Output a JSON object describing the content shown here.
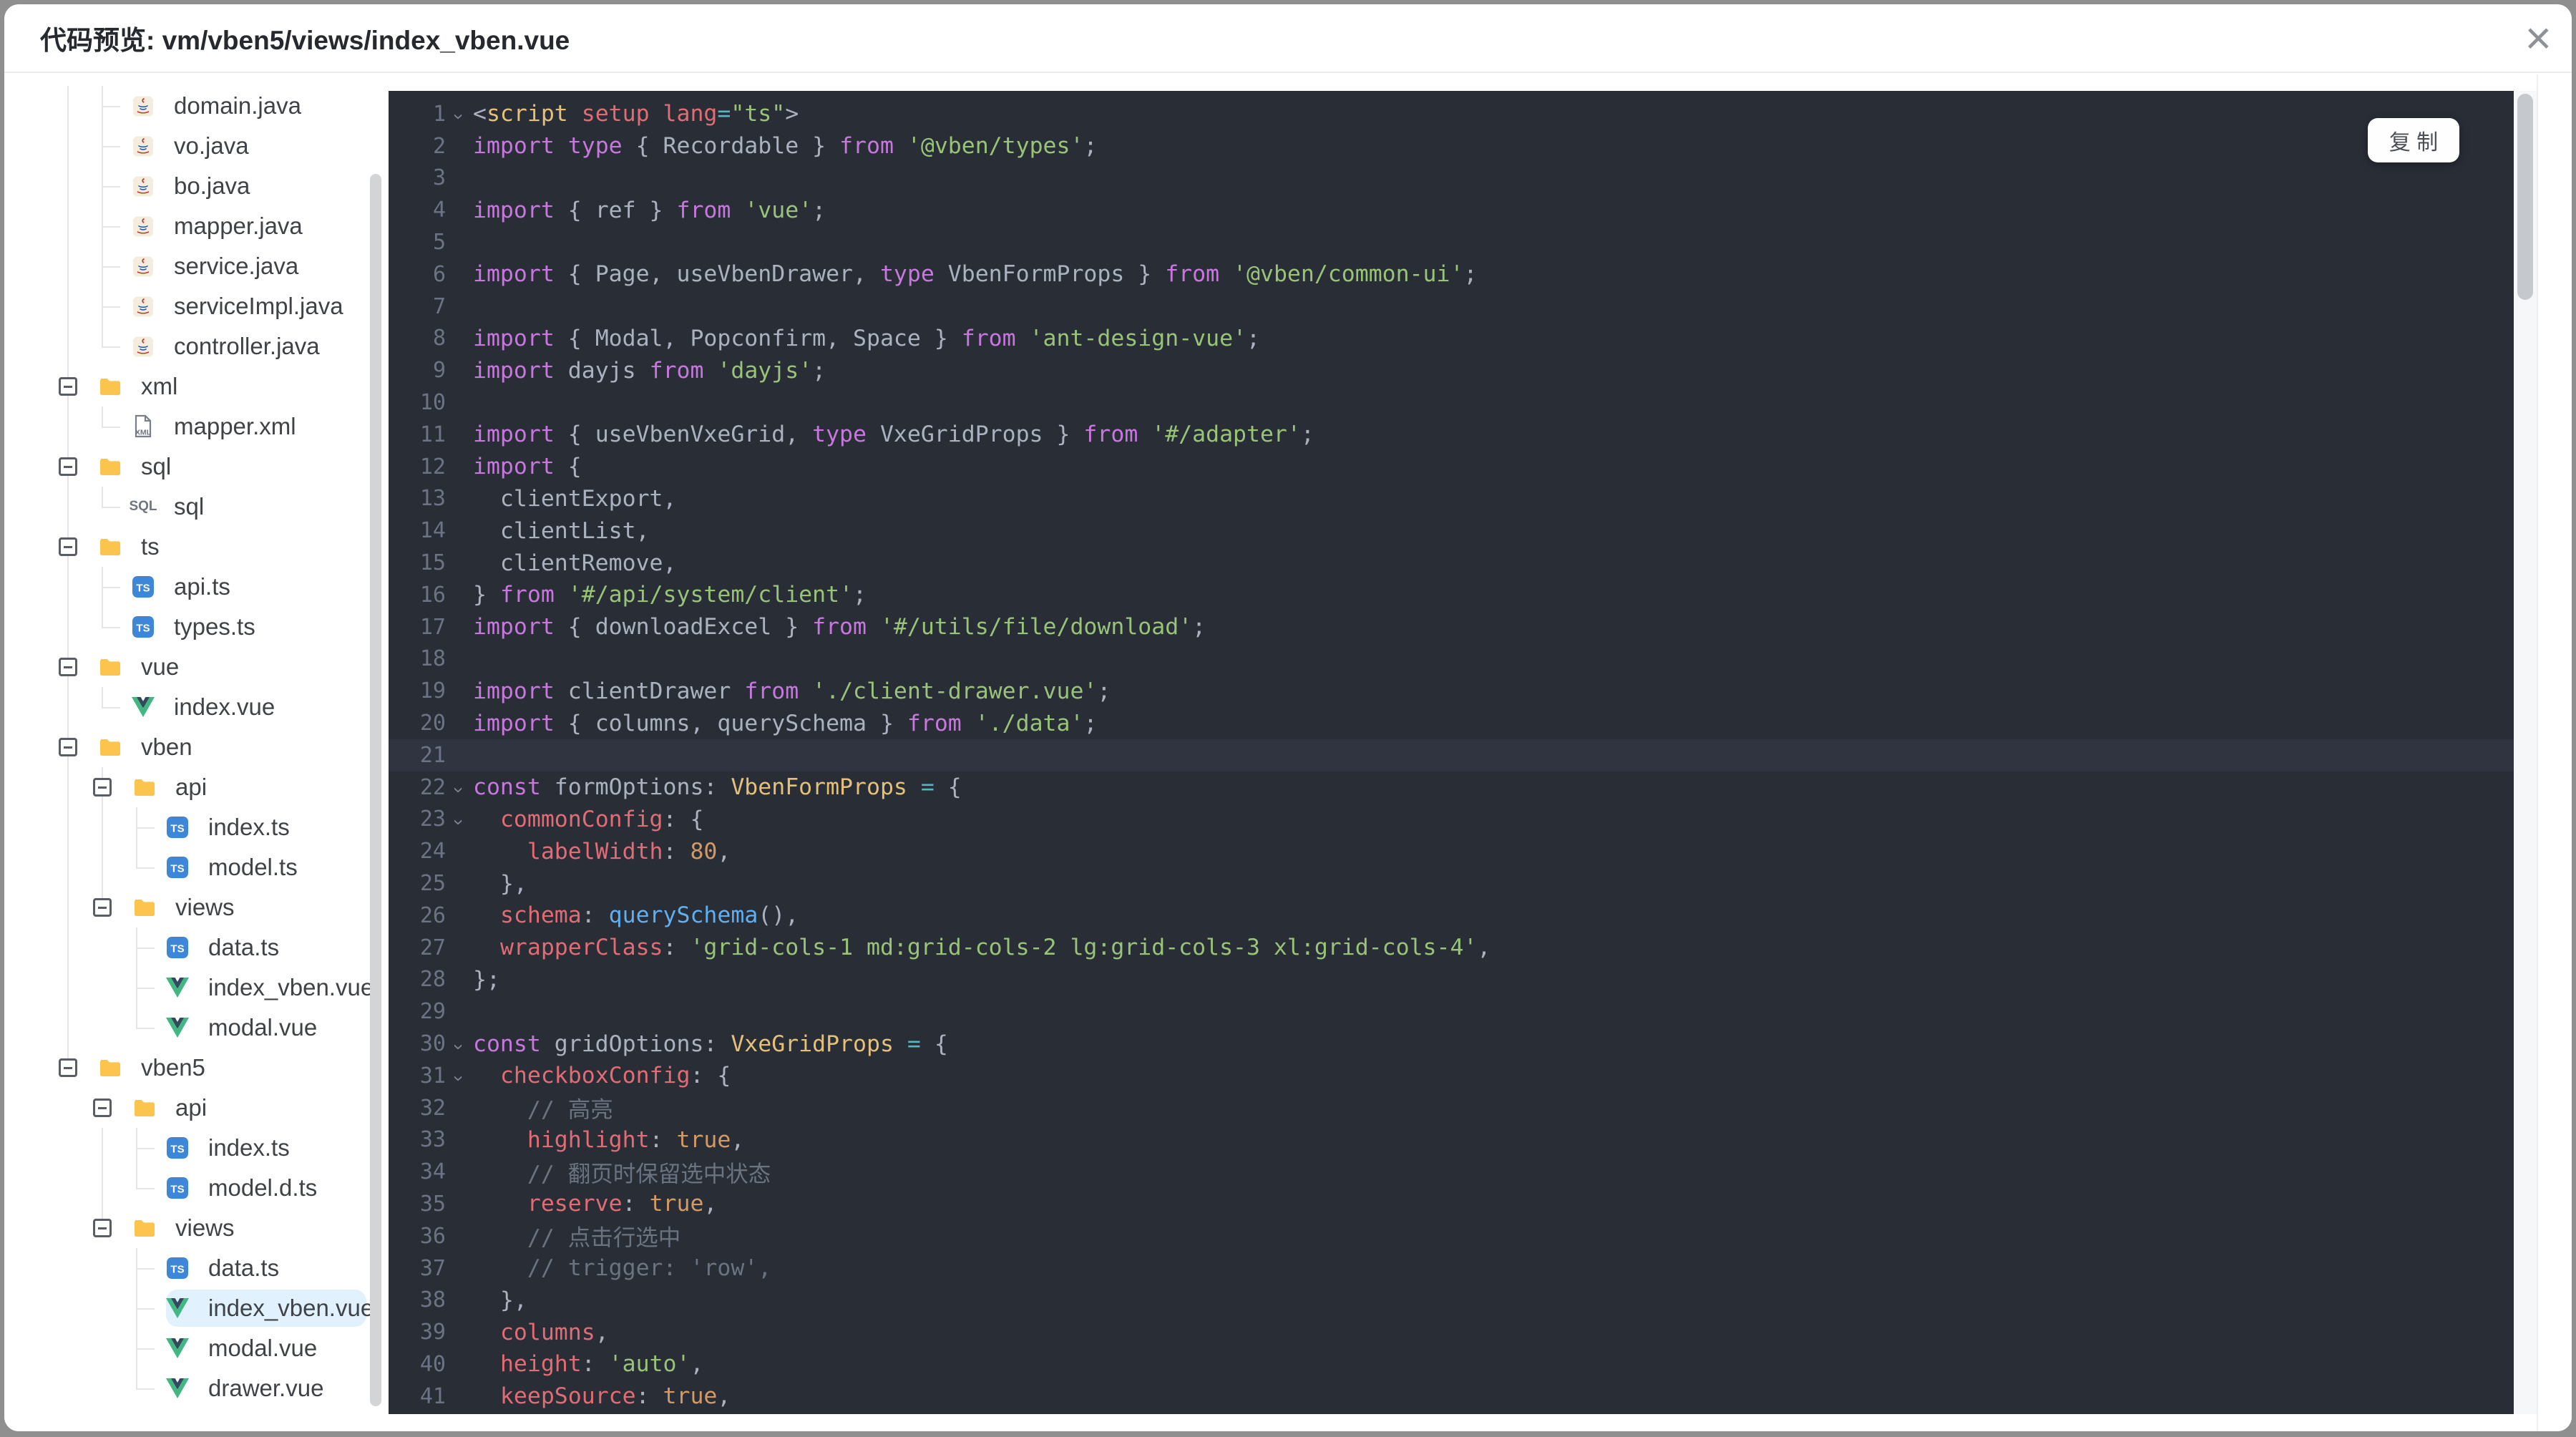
{
  "dialog": {
    "title": "代码预览: vm/vben5/views/index_vben.vue",
    "close_icon": "×"
  },
  "code_panel": {
    "copy_button_label": "复 制"
  },
  "colors": {
    "code_background": "#292D36",
    "active_line_background": "#2F3440",
    "selected_tree_item_background": "#E2F1FE",
    "keyword": "#C678DD",
    "string": "#98C379",
    "property": "#E06C75",
    "type": "#E5C07B",
    "number_bool": "#D19A66",
    "function": "#61AFEF",
    "comment": "#6A7380",
    "ts_icon_blue": "#3E86D8",
    "vue_green": "#41B883",
    "folder_yellow": "#FBC54D"
  },
  "file_tree": {
    "items": [
      {
        "label": "domain.java",
        "type": "file",
        "icon": "java",
        "depth": 1,
        "guides": [
          0
        ],
        "last": false
      },
      {
        "label": "vo.java",
        "type": "file",
        "icon": "java",
        "depth": 1,
        "guides": [
          0
        ],
        "last": false
      },
      {
        "label": "bo.java",
        "type": "file",
        "icon": "java",
        "depth": 1,
        "guides": [
          0
        ],
        "last": false
      },
      {
        "label": "mapper.java",
        "type": "file",
        "icon": "java",
        "depth": 1,
        "guides": [
          0
        ],
        "last": false
      },
      {
        "label": "service.java",
        "type": "file",
        "icon": "java",
        "depth": 1,
        "guides": [
          0
        ],
        "last": false
      },
      {
        "label": "serviceImpl.java",
        "type": "file",
        "icon": "java",
        "depth": 1,
        "guides": [
          0
        ],
        "last": false
      },
      {
        "label": "controller.java",
        "type": "file",
        "icon": "java",
        "depth": 1,
        "guides": [
          0
        ],
        "last": true
      },
      {
        "label": "xml",
        "type": "folder",
        "icon": "folder",
        "depth": 0,
        "guides": [],
        "last": false,
        "expanded": true
      },
      {
        "label": "mapper.xml",
        "type": "file",
        "icon": "xml",
        "depth": 1,
        "guides": [
          0
        ],
        "last": true
      },
      {
        "label": "sql",
        "type": "folder",
        "icon": "folder",
        "depth": 0,
        "guides": [],
        "last": false,
        "expanded": true
      },
      {
        "label": "sql",
        "type": "file",
        "icon": "sql",
        "depth": 1,
        "guides": [
          0
        ],
        "last": true
      },
      {
        "label": "ts",
        "type": "folder",
        "icon": "folder",
        "depth": 0,
        "guides": [],
        "last": false,
        "expanded": true
      },
      {
        "label": "api.ts",
        "type": "file",
        "icon": "ts",
        "depth": 1,
        "guides": [
          0
        ],
        "last": false
      },
      {
        "label": "types.ts",
        "type": "file",
        "icon": "ts",
        "depth": 1,
        "guides": [
          0
        ],
        "last": true
      },
      {
        "label": "vue",
        "type": "folder",
        "icon": "folder",
        "depth": 0,
        "guides": [],
        "last": false,
        "expanded": true
      },
      {
        "label": "index.vue",
        "type": "file",
        "icon": "vue",
        "depth": 1,
        "guides": [
          0
        ],
        "last": true
      },
      {
        "label": "vben",
        "type": "folder",
        "icon": "folder",
        "depth": 0,
        "guides": [],
        "last": false,
        "expanded": true
      },
      {
        "label": "api",
        "type": "folder",
        "icon": "folder",
        "depth": 1,
        "guides": [
          0
        ],
        "last": false,
        "expanded": true
      },
      {
        "label": "index.ts",
        "type": "file",
        "icon": "ts",
        "depth": 2,
        "guides": [
          0,
          1
        ],
        "last": false
      },
      {
        "label": "model.ts",
        "type": "file",
        "icon": "ts",
        "depth": 2,
        "guides": [
          0,
          1
        ],
        "last": true
      },
      {
        "label": "views",
        "type": "folder",
        "icon": "folder",
        "depth": 1,
        "guides": [
          0
        ],
        "last": true,
        "expanded": true
      },
      {
        "label": "data.ts",
        "type": "file",
        "icon": "ts",
        "depth": 2,
        "guides": [
          0
        ],
        "last": false
      },
      {
        "label": "index_vben.vue",
        "type": "file",
        "icon": "vue",
        "depth": 2,
        "guides": [
          0
        ],
        "last": false
      },
      {
        "label": "modal.vue",
        "type": "file",
        "icon": "vue",
        "depth": 2,
        "guides": [
          0
        ],
        "last": true
      },
      {
        "label": "vben5",
        "type": "folder",
        "icon": "folder",
        "depth": 0,
        "guides": [],
        "last": true,
        "expanded": true
      },
      {
        "label": "api",
        "type": "folder",
        "icon": "folder",
        "depth": 1,
        "guides": [],
        "last": false,
        "expanded": true
      },
      {
        "label": "index.ts",
        "type": "file",
        "icon": "ts",
        "depth": 2,
        "guides": [
          1
        ],
        "last": false
      },
      {
        "label": "model.d.ts",
        "type": "file",
        "icon": "ts",
        "depth": 2,
        "guides": [
          1
        ],
        "last": true
      },
      {
        "label": "views",
        "type": "folder",
        "icon": "folder",
        "depth": 1,
        "guides": [],
        "last": true,
        "expanded": true
      },
      {
        "label": "data.ts",
        "type": "file",
        "icon": "ts",
        "depth": 2,
        "guides": [],
        "last": false
      },
      {
        "label": "index_vben.vue",
        "type": "file",
        "icon": "vue",
        "depth": 2,
        "guides": [],
        "last": false,
        "selected": true
      },
      {
        "label": "modal.vue",
        "type": "file",
        "icon": "vue",
        "depth": 2,
        "guides": [],
        "last": false
      },
      {
        "label": "drawer.vue",
        "type": "file",
        "icon": "vue",
        "depth": 2,
        "guides": [],
        "last": true
      }
    ]
  },
  "code": {
    "language": "vue-ts",
    "lines": [
      {
        "n": 1,
        "fold": true,
        "tokens": [
          [
            "t",
            "<"
          ],
          [
            "tag",
            "script"
          ],
          [
            "t",
            " "
          ],
          [
            "attr",
            "setup"
          ],
          [
            "t",
            " "
          ],
          [
            "attr",
            "lang"
          ],
          [
            "op",
            "="
          ],
          [
            "str",
            "\"ts\""
          ],
          [
            "t",
            ">"
          ]
        ]
      },
      {
        "n": 2,
        "tokens": [
          [
            "kw",
            "import"
          ],
          [
            "t",
            " "
          ],
          [
            "kw",
            "type"
          ],
          [
            "t",
            " { Recordable } "
          ],
          [
            "kw",
            "from"
          ],
          [
            "t",
            " "
          ],
          [
            "str",
            "'@vben/types'"
          ],
          [
            "t",
            ";"
          ]
        ]
      },
      {
        "n": 3,
        "tokens": []
      },
      {
        "n": 4,
        "tokens": [
          [
            "kw",
            "import"
          ],
          [
            "t",
            " { ref } "
          ],
          [
            "kw",
            "from"
          ],
          [
            "t",
            " "
          ],
          [
            "str",
            "'vue'"
          ],
          [
            "t",
            ";"
          ]
        ]
      },
      {
        "n": 5,
        "tokens": []
      },
      {
        "n": 6,
        "tokens": [
          [
            "kw",
            "import"
          ],
          [
            "t",
            " { Page, useVbenDrawer, "
          ],
          [
            "kw",
            "type"
          ],
          [
            "t",
            " VbenFormProps } "
          ],
          [
            "kw",
            "from"
          ],
          [
            "t",
            " "
          ],
          [
            "str",
            "'@vben/common-ui'"
          ],
          [
            "t",
            ";"
          ]
        ]
      },
      {
        "n": 7,
        "tokens": []
      },
      {
        "n": 8,
        "tokens": [
          [
            "kw",
            "import"
          ],
          [
            "t",
            " { Modal, Popconfirm, Space } "
          ],
          [
            "kw",
            "from"
          ],
          [
            "t",
            " "
          ],
          [
            "str",
            "'ant-design-vue'"
          ],
          [
            "t",
            ";"
          ]
        ]
      },
      {
        "n": 9,
        "tokens": [
          [
            "kw",
            "import"
          ],
          [
            "t",
            " dayjs "
          ],
          [
            "kw",
            "from"
          ],
          [
            "t",
            " "
          ],
          [
            "str",
            "'dayjs'"
          ],
          [
            "t",
            ";"
          ]
        ]
      },
      {
        "n": 10,
        "tokens": []
      },
      {
        "n": 11,
        "tokens": [
          [
            "kw",
            "import"
          ],
          [
            "t",
            " { useVbenVxeGrid, "
          ],
          [
            "kw",
            "type"
          ],
          [
            "t",
            " VxeGridProps } "
          ],
          [
            "kw",
            "from"
          ],
          [
            "t",
            " "
          ],
          [
            "str",
            "'#/adapter'"
          ],
          [
            "t",
            ";"
          ]
        ]
      },
      {
        "n": 12,
        "tokens": [
          [
            "kw",
            "import"
          ],
          [
            "t",
            " {"
          ]
        ]
      },
      {
        "n": 13,
        "tokens": [
          [
            "t",
            "  clientExport,"
          ]
        ]
      },
      {
        "n": 14,
        "tokens": [
          [
            "t",
            "  clientList,"
          ]
        ]
      },
      {
        "n": 15,
        "tokens": [
          [
            "t",
            "  clientRemove,"
          ]
        ]
      },
      {
        "n": 16,
        "tokens": [
          [
            "t",
            "} "
          ],
          [
            "kw",
            "from"
          ],
          [
            "t",
            " "
          ],
          [
            "str",
            "'#/api/system/client'"
          ],
          [
            "t",
            ";"
          ]
        ]
      },
      {
        "n": 17,
        "tokens": [
          [
            "kw",
            "import"
          ],
          [
            "t",
            " { downloadExcel } "
          ],
          [
            "kw",
            "from"
          ],
          [
            "t",
            " "
          ],
          [
            "str",
            "'#/utils/file/download'"
          ],
          [
            "t",
            ";"
          ]
        ]
      },
      {
        "n": 18,
        "tokens": []
      },
      {
        "n": 19,
        "tokens": [
          [
            "kw",
            "import"
          ],
          [
            "t",
            " clientDrawer "
          ],
          [
            "kw",
            "from"
          ],
          [
            "t",
            " "
          ],
          [
            "str",
            "'./client-drawer.vue'"
          ],
          [
            "t",
            ";"
          ]
        ]
      },
      {
        "n": 20,
        "tokens": [
          [
            "kw",
            "import"
          ],
          [
            "t",
            " { columns, querySchema } "
          ],
          [
            "kw",
            "from"
          ],
          [
            "t",
            " "
          ],
          [
            "str",
            "'./data'"
          ],
          [
            "t",
            ";"
          ]
        ]
      },
      {
        "n": 21,
        "active": true,
        "tokens": []
      },
      {
        "n": 22,
        "fold": true,
        "tokens": [
          [
            "kw",
            "const"
          ],
          [
            "t",
            " formOptions: "
          ],
          [
            "typ",
            "VbenFormProps"
          ],
          [
            "t",
            " "
          ],
          [
            "op",
            "="
          ],
          [
            "t",
            " {"
          ]
        ]
      },
      {
        "n": 23,
        "fold": true,
        "tokens": [
          [
            "t",
            "  "
          ],
          [
            "prop",
            "commonConfig"
          ],
          [
            "t",
            ": {"
          ]
        ]
      },
      {
        "n": 24,
        "tokens": [
          [
            "t",
            "    "
          ],
          [
            "prop",
            "labelWidth"
          ],
          [
            "t",
            ": "
          ],
          [
            "num",
            "80"
          ],
          [
            "t",
            ","
          ]
        ]
      },
      {
        "n": 25,
        "tokens": [
          [
            "t",
            "  },"
          ]
        ]
      },
      {
        "n": 26,
        "tokens": [
          [
            "t",
            "  "
          ],
          [
            "prop",
            "schema"
          ],
          [
            "t",
            ": "
          ],
          [
            "fn",
            "querySchema"
          ],
          [
            "t",
            "(),"
          ]
        ]
      },
      {
        "n": 27,
        "tokens": [
          [
            "t",
            "  "
          ],
          [
            "prop",
            "wrapperClass"
          ],
          [
            "t",
            ": "
          ],
          [
            "str",
            "'grid-cols-1 md:grid-cols-2 lg:grid-cols-3 xl:grid-cols-4'"
          ],
          [
            "t",
            ","
          ]
        ]
      },
      {
        "n": 28,
        "tokens": [
          [
            "t",
            "};"
          ]
        ]
      },
      {
        "n": 29,
        "tokens": []
      },
      {
        "n": 30,
        "fold": true,
        "tokens": [
          [
            "kw",
            "const"
          ],
          [
            "t",
            " gridOptions: "
          ],
          [
            "typ",
            "VxeGridProps"
          ],
          [
            "t",
            " "
          ],
          [
            "op",
            "="
          ],
          [
            "t",
            " {"
          ]
        ]
      },
      {
        "n": 31,
        "fold": true,
        "tokens": [
          [
            "t",
            "  "
          ],
          [
            "prop",
            "checkboxConfig"
          ],
          [
            "t",
            ": {"
          ]
        ]
      },
      {
        "n": 32,
        "tokens": [
          [
            "t",
            "    "
          ],
          [
            "cm",
            "// 高亮"
          ]
        ]
      },
      {
        "n": 33,
        "tokens": [
          [
            "t",
            "    "
          ],
          [
            "prop",
            "highlight"
          ],
          [
            "t",
            ": "
          ],
          [
            "num",
            "true"
          ],
          [
            "t",
            ","
          ]
        ]
      },
      {
        "n": 34,
        "tokens": [
          [
            "t",
            "    "
          ],
          [
            "cm",
            "// 翻页时保留选中状态"
          ]
        ]
      },
      {
        "n": 35,
        "tokens": [
          [
            "t",
            "    "
          ],
          [
            "prop",
            "reserve"
          ],
          [
            "t",
            ": "
          ],
          [
            "num",
            "true"
          ],
          [
            "t",
            ","
          ]
        ]
      },
      {
        "n": 36,
        "tokens": [
          [
            "t",
            "    "
          ],
          [
            "cm",
            "// 点击行选中"
          ]
        ]
      },
      {
        "n": 37,
        "tokens": [
          [
            "t",
            "    "
          ],
          [
            "cm",
            "// trigger: 'row',"
          ]
        ]
      },
      {
        "n": 38,
        "tokens": [
          [
            "t",
            "  },"
          ]
        ]
      },
      {
        "n": 39,
        "tokens": [
          [
            "t",
            "  "
          ],
          [
            "prop",
            "columns"
          ],
          [
            "t",
            ","
          ]
        ]
      },
      {
        "n": 40,
        "tokens": [
          [
            "t",
            "  "
          ],
          [
            "prop",
            "height"
          ],
          [
            "t",
            ": "
          ],
          [
            "str",
            "'auto'"
          ],
          [
            "t",
            ","
          ]
        ]
      },
      {
        "n": 41,
        "tokens": [
          [
            "t",
            "  "
          ],
          [
            "prop",
            "keepSource"
          ],
          [
            "t",
            ": "
          ],
          [
            "num",
            "true"
          ],
          [
            "t",
            ","
          ]
        ]
      }
    ]
  }
}
